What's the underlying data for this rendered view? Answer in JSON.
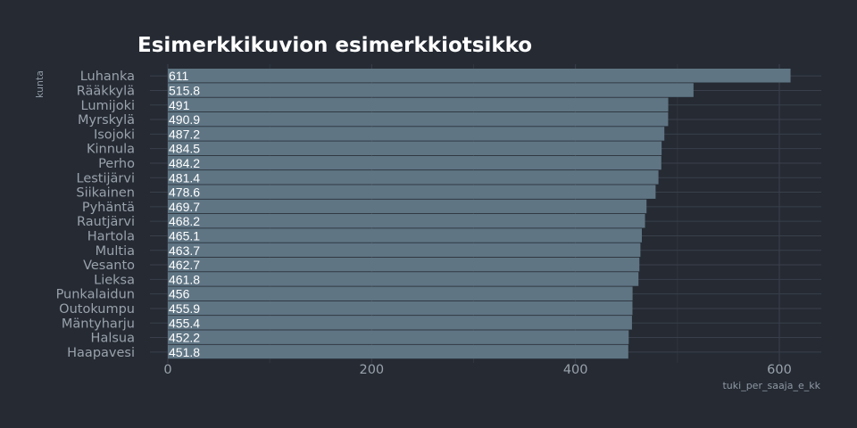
{
  "chart_data": {
    "type": "bar",
    "orientation": "horizontal",
    "title": "Esimerkkikuvion esimerkkiotsikko",
    "xlabel": "tuki_per_saaja_e_kk",
    "ylabel": "kunta",
    "categories": [
      "Luhanka",
      "Rääkkylä",
      "Lumijoki",
      "Myrskylä",
      "Isojoki",
      "Kinnula",
      "Perho",
      "Lestijärvi",
      "Siikainen",
      "Pyhäntä",
      "Rautjärvi",
      "Hartola",
      "Multia",
      "Vesanto",
      "Lieksa",
      "Punkalaidun",
      "Outokumpu",
      "Mäntyharju",
      "Halsua",
      "Haapavesi"
    ],
    "values": [
      611,
      515.8,
      491,
      490.9,
      487.2,
      484.5,
      484.2,
      481.4,
      478.6,
      469.7,
      468.2,
      465.1,
      463.7,
      462.7,
      461.8,
      456,
      455.9,
      455.4,
      452.2,
      451.8
    ],
    "value_labels": [
      "611",
      "515.8",
      "491",
      "490.9",
      "487.2",
      "484.5",
      "484.2",
      "481.4",
      "478.6",
      "469.7",
      "468.2",
      "465.1",
      "463.7",
      "462.7",
      "461.8",
      "456",
      "455.9",
      "455.4",
      "452.2",
      "451.8"
    ],
    "xticks": [
      "0",
      "200",
      "400",
      "600"
    ],
    "xtick_values": [
      0,
      200,
      400,
      600
    ],
    "xlim": [
      0,
      640
    ],
    "grid": true,
    "legend": "none",
    "colors": {
      "background": "#252a33",
      "bar": "#5f7584",
      "title": "#ffffff",
      "label": "#9aa2ab"
    }
  }
}
